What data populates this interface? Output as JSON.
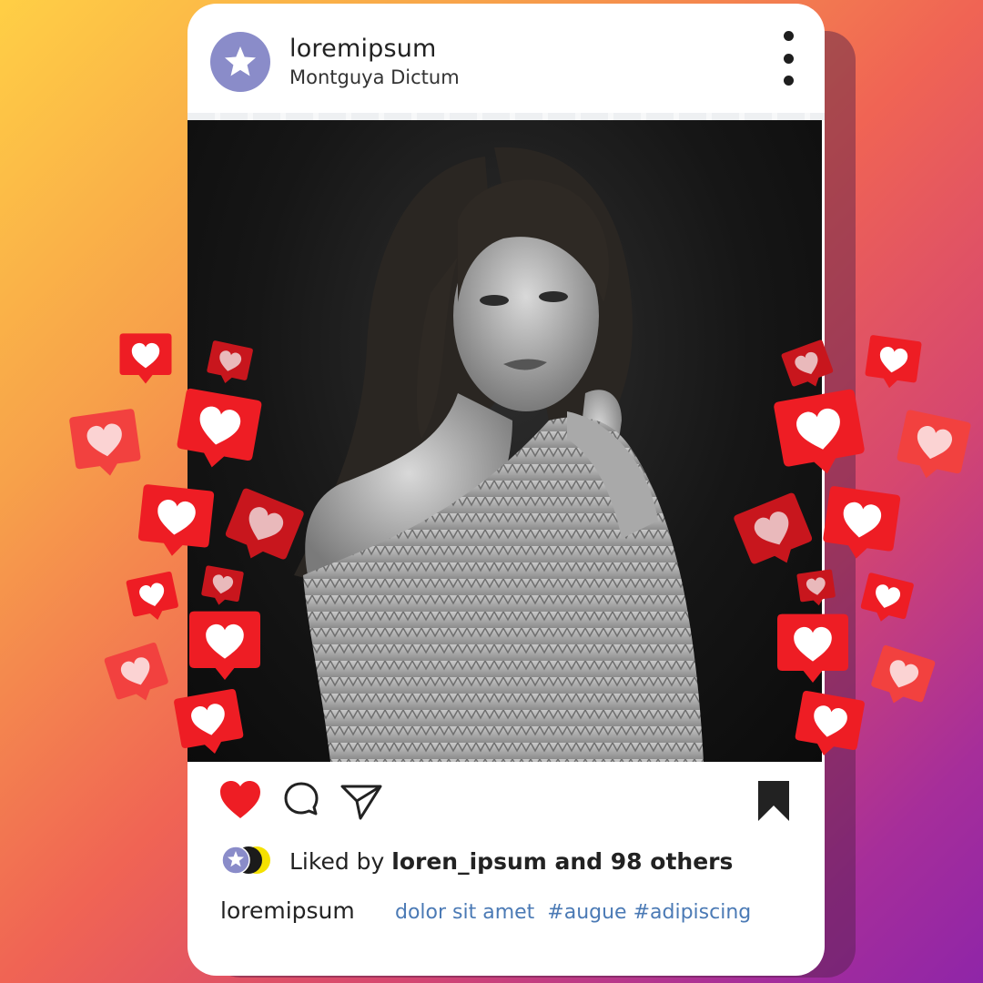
{
  "post": {
    "username": "loremipsum",
    "location": "Montguya Dictum",
    "liked_prefix": "Liked by ",
    "liked_by": "loren_ipsum and 98 others",
    "caption_user": "loremipsum",
    "caption_text": "dolor sit amet  #augue #adipiscing"
  },
  "icons": {
    "avatar": "star-icon",
    "menu": "more-vertical-icon",
    "like": "heart-icon",
    "comment": "comment-bubble-icon",
    "share": "paper-plane-icon",
    "save": "bookmark-icon",
    "reaction": "heart-speech-bubble-icon"
  },
  "colors": {
    "avatar": "#8a8cc9",
    "like": "#ee1d24",
    "hashtag": "#4b7ab5",
    "text": "#222222",
    "mini_avatar_yellow": "#f5e100"
  }
}
